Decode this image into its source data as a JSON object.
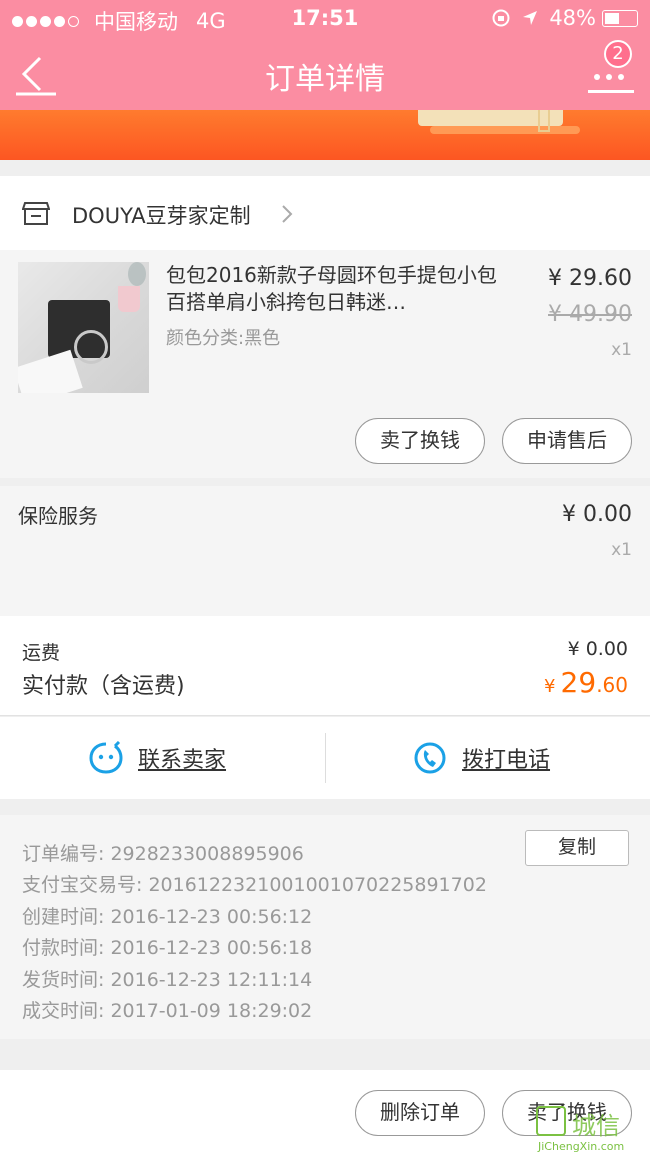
{
  "status_bar": {
    "carrier": "中国移动",
    "network": "4G",
    "time": "17:51",
    "battery": "48%"
  },
  "nav": {
    "title": "订单详情",
    "badge": "2"
  },
  "shop": {
    "name": "DOUYA豆芽家定制"
  },
  "product": {
    "title": "包包2016新款子母圆环包手提包小包百搭单肩小斜挎包日韩迷…",
    "spec": "颜色分类:黑色",
    "price": "¥ 29.60",
    "original_price": "¥ 49.90",
    "quantity": "x1",
    "sell_button": "卖了换钱",
    "aftersale_button": "申请售后"
  },
  "insurance": {
    "label": "保险服务",
    "price": "¥ 0.00",
    "quantity": "x1"
  },
  "payment": {
    "shipping_label": "运费",
    "shipping_value": "¥ 0.00",
    "total_label": "实付款（含运费)",
    "total_currency": "¥",
    "total_int": "29",
    "total_dec": ".60"
  },
  "contact": {
    "seller": "联系卖家",
    "phone": "拨打电话"
  },
  "order_info": {
    "order_no": "订单编号:   2928233008895906",
    "alipay_no": "支付宝交易号:   2016122321001001070225891702",
    "created": "创建时间:   2016-12-23 00:56:12",
    "paid": "付款时间:   2016-12-23 00:56:18",
    "shipped": "发货时间:   2016-12-23 12:11:14",
    "completed": "成交时间:   2017-01-09 18:29:02",
    "copy_button": "复制"
  },
  "footer": {
    "delete_button": "删除订单",
    "sell_button": "卖了换钱"
  },
  "watermark": {
    "text": "城信",
    "sub": "JiChengXin.com"
  },
  "colors": {
    "header": "#fb8da2",
    "accent": "#ff6a00",
    "icon_blue": "#1ba1e6"
  }
}
